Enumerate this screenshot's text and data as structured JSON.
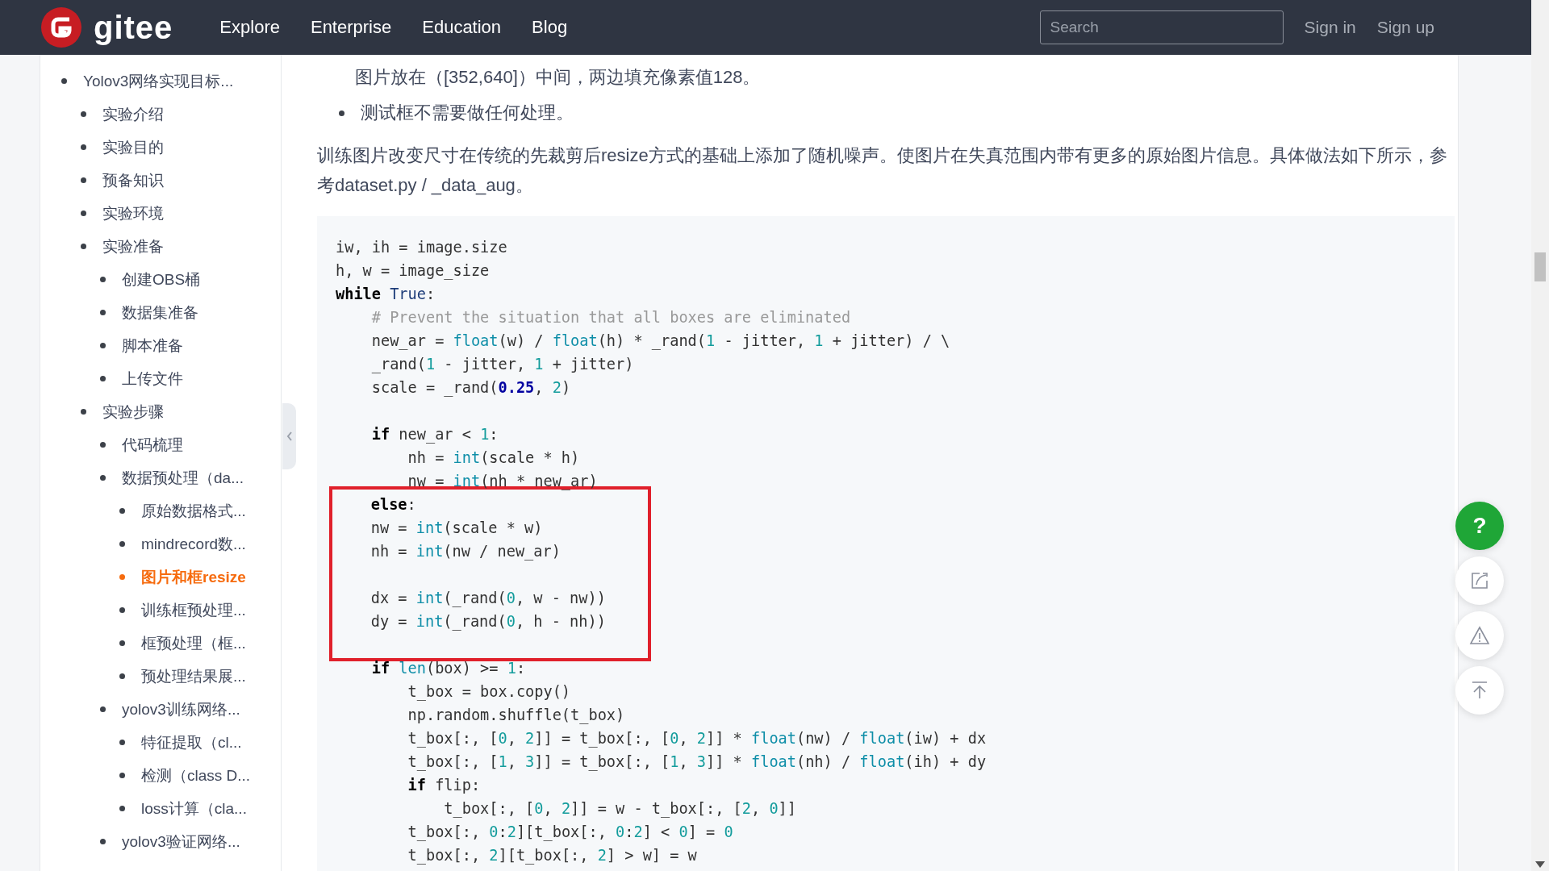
{
  "header": {
    "logo": "gitee",
    "nav": [
      "Explore",
      "Enterprise",
      "Education",
      "Blog"
    ],
    "search": {
      "placeholder": "Search"
    },
    "auth": [
      "Sign in",
      "Sign up"
    ]
  },
  "sidebar": {
    "items": [
      {
        "label": "Yolov3网络实现目标...",
        "selected": false,
        "children": [
          {
            "label": "实验介绍",
            "selected": false
          },
          {
            "label": "实验目的",
            "selected": false
          },
          {
            "label": "预备知识",
            "selected": false
          },
          {
            "label": "实验环境",
            "selected": false
          },
          {
            "label": "实验准备",
            "selected": false,
            "children": [
              {
                "label": "创建OBS桶",
                "selected": false
              },
              {
                "label": "数据集准备",
                "selected": false
              },
              {
                "label": "脚本准备",
                "selected": false
              },
              {
                "label": "上传文件",
                "selected": false
              }
            ]
          },
          {
            "label": "实验步骤",
            "selected": false,
            "children": [
              {
                "label": "代码梳理",
                "selected": false
              },
              {
                "label": "数据预处理（da...",
                "selected": false,
                "children": [
                  {
                    "label": "原始数据格式...",
                    "selected": false
                  },
                  {
                    "label": "mindrecord数...",
                    "selected": false
                  },
                  {
                    "label": "图片和框resize",
                    "selected": true
                  },
                  {
                    "label": "训练框预处理...",
                    "selected": false
                  },
                  {
                    "label": "框预处理（框...",
                    "selected": false
                  },
                  {
                    "label": "预处理结果展...",
                    "selected": false
                  }
                ]
              },
              {
                "label": "yolov3训练网络...",
                "selected": false,
                "children": [
                  {
                    "label": "特征提取（cl...",
                    "selected": false
                  },
                  {
                    "label": "检测（class D...",
                    "selected": false
                  },
                  {
                    "label": "loss计算（cla...",
                    "selected": false
                  }
                ]
              },
              {
                "label": "yolov3验证网络...",
                "selected": false
              }
            ]
          }
        ]
      }
    ]
  },
  "article": {
    "continued_text": "图片放在（[352,640]）中间，两边填充像素值128。",
    "bullets": [
      "测试框不需要做任何处理。"
    ],
    "paragraph": "训练图片改变尺寸在传统的先裁剪后resize方式的基础上添加了随机噪声。使图片在失真范围内带有更多的原始图片信息。具体做法如下所示，参考dataset.py / _data_aug。",
    "code": [
      {
        "boxed": false,
        "lines": [
          {
            "kind": "code",
            "tokens": [
              {
                "kind": "plain",
                "t": "iw, ih = image.size"
              }
            ]
          },
          {
            "kind": "code",
            "tokens": [
              {
                "kind": "plain",
                "t": "h, w = image_size"
              }
            ]
          },
          {
            "kind": "code",
            "tokens": [
              {
                "kind": "keyword",
                "t": "while"
              },
              {
                "kind": "constant",
                "t": " True"
              },
              {
                "kind": "plain",
                "t": ":"
              }
            ]
          },
          {
            "kind": "code",
            "tokens": [
              {
                "kind": "comment",
                "t": "    # Prevent the situation that all boxes are eliminated"
              }
            ]
          },
          {
            "kind": "code",
            "tokens": [
              {
                "kind": "plain",
                "t": "    new_ar = "
              },
              {
                "kind": "builtin",
                "t": "float"
              },
              {
                "kind": "plain",
                "t": "(w) / "
              },
              {
                "kind": "builtin",
                "t": "float"
              },
              {
                "kind": "plain",
                "t": "(h) * _rand("
              },
              {
                "kind": "number",
                "t": "1"
              },
              {
                "kind": "plain",
                "t": " - jitter, "
              },
              {
                "kind": "number",
                "t": "1"
              },
              {
                "kind": "plain",
                "t": " + jitter) / \\"
              }
            ]
          },
          {
            "kind": "code",
            "tokens": [
              {
                "kind": "plain",
                "t": "    _rand("
              },
              {
                "kind": "number",
                "t": "1"
              },
              {
                "kind": "plain",
                "t": " - jitter, "
              },
              {
                "kind": "number",
                "t": "1"
              },
              {
                "kind": "plain",
                "t": " + jitter)"
              }
            ]
          },
          {
            "kind": "code",
            "tokens": [
              {
                "kind": "plain",
                "t": "    scale = _rand("
              },
              {
                "kind": "float",
                "t": "0.25"
              },
              {
                "kind": "plain",
                "t": ", "
              },
              {
                "kind": "number",
                "t": "2"
              },
              {
                "kind": "plain",
                "t": ")"
              }
            ]
          },
          {
            "kind": "blank"
          },
          {
            "kind": "code",
            "tokens": [
              {
                "kind": "keyword",
                "t": "    if"
              },
              {
                "kind": "plain",
                "t": " new_ar < "
              },
              {
                "kind": "number",
                "t": "1"
              },
              {
                "kind": "plain",
                "t": ":"
              }
            ]
          },
          {
            "kind": "code",
            "tokens": [
              {
                "kind": "plain",
                "t": "        nh = "
              },
              {
                "kind": "builtin",
                "t": "int"
              },
              {
                "kind": "plain",
                "t": "(scale * h)"
              }
            ]
          },
          {
            "kind": "code",
            "tokens": [
              {
                "kind": "plain",
                "t": "        nw = "
              },
              {
                "kind": "builtin",
                "t": "int"
              },
              {
                "kind": "plain",
                "t": "(nh * new_ar)"
              }
            ]
          }
        ]
      },
      {
        "boxed": true,
        "lines": [
          {
            "kind": "code",
            "tokens": [
              {
                "kind": "keyword",
                "t": "    else"
              },
              {
                "kind": "plain",
                "t": ":"
              }
            ]
          },
          {
            "kind": "code",
            "tokens": [
              {
                "kind": "plain",
                "t": "    nw = "
              },
              {
                "kind": "builtin",
                "t": "int"
              },
              {
                "kind": "plain",
                "t": "(scale * w)"
              }
            ]
          },
          {
            "kind": "code",
            "tokens": [
              {
                "kind": "plain",
                "t": "    nh = "
              },
              {
                "kind": "builtin",
                "t": "int"
              },
              {
                "kind": "plain",
                "t": "(nw / new_ar)"
              }
            ]
          },
          {
            "kind": "blank"
          },
          {
            "kind": "code",
            "tokens": [
              {
                "kind": "plain",
                "t": "    dx = "
              },
              {
                "kind": "builtin",
                "t": "int"
              },
              {
                "kind": "plain",
                "t": "(_rand("
              },
              {
                "kind": "number",
                "t": "0"
              },
              {
                "kind": "plain",
                "t": ", w - nw))"
              }
            ]
          },
          {
            "kind": "code",
            "tokens": [
              {
                "kind": "plain",
                "t": "    dy = "
              },
              {
                "kind": "builtin",
                "t": "int"
              },
              {
                "kind": "plain",
                "t": "(_rand("
              },
              {
                "kind": "number",
                "t": "0"
              },
              {
                "kind": "plain",
                "t": ", h - nh))"
              }
            ]
          },
          {
            "kind": "blank"
          }
        ]
      },
      {
        "boxed": false,
        "lines": [
          {
            "kind": "code",
            "tokens": [
              {
                "kind": "keyword",
                "t": "    if"
              },
              {
                "kind": "builtin",
                "t": " len"
              },
              {
                "kind": "plain",
                "t": "(box) >= "
              },
              {
                "kind": "number",
                "t": "1"
              },
              {
                "kind": "plain",
                "t": ":"
              }
            ]
          },
          {
            "kind": "code",
            "tokens": [
              {
                "kind": "plain",
                "t": "        t_box = box.copy()"
              }
            ]
          },
          {
            "kind": "code",
            "tokens": [
              {
                "kind": "plain",
                "t": "        np.random.shuffle(t_box)"
              }
            ]
          },
          {
            "kind": "code",
            "tokens": [
              {
                "kind": "plain",
                "t": "        t_box[:, ["
              },
              {
                "kind": "number",
                "t": "0"
              },
              {
                "kind": "plain",
                "t": ", "
              },
              {
                "kind": "number",
                "t": "2"
              },
              {
                "kind": "plain",
                "t": "]] = t_box[:, ["
              },
              {
                "kind": "number",
                "t": "0"
              },
              {
                "kind": "plain",
                "t": ", "
              },
              {
                "kind": "number",
                "t": "2"
              },
              {
                "kind": "plain",
                "t": "]] * "
              },
              {
                "kind": "builtin",
                "t": "float"
              },
              {
                "kind": "plain",
                "t": "(nw) / "
              },
              {
                "kind": "builtin",
                "t": "float"
              },
              {
                "kind": "plain",
                "t": "(iw) + dx"
              }
            ]
          },
          {
            "kind": "code",
            "tokens": [
              {
                "kind": "plain",
                "t": "        t_box[:, ["
              },
              {
                "kind": "number",
                "t": "1"
              },
              {
                "kind": "plain",
                "t": ", "
              },
              {
                "kind": "number",
                "t": "3"
              },
              {
                "kind": "plain",
                "t": "]] = t_box[:, ["
              },
              {
                "kind": "number",
                "t": "1"
              },
              {
                "kind": "plain",
                "t": ", "
              },
              {
                "kind": "number",
                "t": "3"
              },
              {
                "kind": "plain",
                "t": "]] * "
              },
              {
                "kind": "builtin",
                "t": "float"
              },
              {
                "kind": "plain",
                "t": "(nh) / "
              },
              {
                "kind": "builtin",
                "t": "float"
              },
              {
                "kind": "plain",
                "t": "(ih) + dy"
              }
            ]
          },
          {
            "kind": "code",
            "tokens": [
              {
                "kind": "keyword",
                "t": "        if"
              },
              {
                "kind": "plain",
                "t": " flip:"
              }
            ]
          },
          {
            "kind": "code",
            "tokens": [
              {
                "kind": "plain",
                "t": "            t_box[:, ["
              },
              {
                "kind": "number",
                "t": "0"
              },
              {
                "kind": "plain",
                "t": ", "
              },
              {
                "kind": "number",
                "t": "2"
              },
              {
                "kind": "plain",
                "t": "]] = w - t_box[:, ["
              },
              {
                "kind": "number",
                "t": "2"
              },
              {
                "kind": "plain",
                "t": ", "
              },
              {
                "kind": "number",
                "t": "0"
              },
              {
                "kind": "plain",
                "t": "]]"
              }
            ]
          },
          {
            "kind": "code",
            "tokens": [
              {
                "kind": "plain",
                "t": "        t_box[:, "
              },
              {
                "kind": "number",
                "t": "0"
              },
              {
                "kind": "plain",
                "t": ":"
              },
              {
                "kind": "number",
                "t": "2"
              },
              {
                "kind": "plain",
                "t": "][t_box[:, "
              },
              {
                "kind": "number",
                "t": "0"
              },
              {
                "kind": "plain",
                "t": ":"
              },
              {
                "kind": "number",
                "t": "2"
              },
              {
                "kind": "plain",
                "t": "] < "
              },
              {
                "kind": "number",
                "t": "0"
              },
              {
                "kind": "plain",
                "t": "] = "
              },
              {
                "kind": "number",
                "t": "0"
              }
            ]
          },
          {
            "kind": "code",
            "tokens": [
              {
                "kind": "plain",
                "t": "        t_box[:, "
              },
              {
                "kind": "number",
                "t": "2"
              },
              {
                "kind": "plain",
                "t": "][t_box[:, "
              },
              {
                "kind": "number",
                "t": "2"
              },
              {
                "kind": "plain",
                "t": "] > w] = w"
              }
            ]
          }
        ]
      }
    ]
  },
  "float_buttons": [
    {
      "kind": "help",
      "label": "?"
    },
    {
      "kind": "share"
    },
    {
      "kind": "report"
    },
    {
      "kind": "top"
    }
  ]
}
